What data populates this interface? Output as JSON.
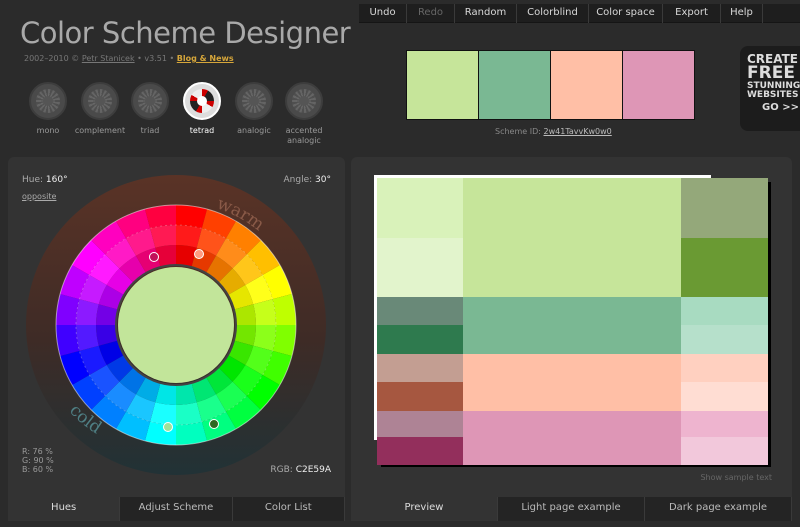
{
  "app": {
    "title": "Color Scheme Designer",
    "credits_prefix": "2002–2010 ©",
    "author": "Petr Stanicek",
    "version": "• v3.51 •",
    "blog": "Blog & News"
  },
  "menu": [
    {
      "label": "Undo",
      "disabled": false,
      "width": 48
    },
    {
      "label": "Redo",
      "disabled": true,
      "width": 48
    },
    {
      "label": "Random",
      "disabled": false,
      "width": 62
    },
    {
      "label": "Colorblind",
      "disabled": false,
      "width": 72
    },
    {
      "label": "Color space",
      "disabled": false,
      "width": 74
    },
    {
      "label": "Export",
      "disabled": false,
      "width": 58
    },
    {
      "label": "Help",
      "disabled": false,
      "width": 42
    }
  ],
  "modes": [
    {
      "label": "mono",
      "active": false
    },
    {
      "label": "complement",
      "active": false
    },
    {
      "label": "triad",
      "active": false
    },
    {
      "label": "tetrad",
      "active": true
    },
    {
      "label": "analogic",
      "active": false
    },
    {
      "label": "accented analogic",
      "active": false
    }
  ],
  "scheme": {
    "swatches": [
      "#C6E59A",
      "#7AB893",
      "#FFBFA6",
      "#DE96B6"
    ],
    "id_label": "Scheme ID:",
    "id_value": "2w41TavvKw0w0"
  },
  "ad": {
    "line1": "CREATE",
    "line2": "FREE",
    "line3": "STUNNING",
    "line4": "WEBSITES",
    "go": "GO >>"
  },
  "wheel": {
    "hue_label": "Hue:",
    "hue_value": "160°",
    "opposite": "opposite",
    "angle_label": "Angle:",
    "angle_value": "30°",
    "warm": "warm",
    "cold": "cold",
    "center_color": "#C2E59A",
    "r": "R: 76 %",
    "g": "G: 90 %",
    "b": "B: 60 %",
    "rgb_label": "RGB:",
    "rgb_value": "C2E59A"
  },
  "left_tabs": [
    {
      "label": "Hues",
      "active": true
    },
    {
      "label": "Adjust Scheme",
      "active": false
    },
    {
      "label": "Color List",
      "active": false
    }
  ],
  "right_tabs": [
    {
      "label": "Preview",
      "active": true
    },
    {
      "label": "Light page example",
      "active": false
    },
    {
      "label": "Dark page example",
      "active": false
    }
  ],
  "preview": {
    "show_text": "Show sample text",
    "rows": [
      [
        "#D9F2BA",
        "#C6E59A",
        "#94A87A"
      ],
      [
        "#E2F4CC",
        "#C6E59A",
        "#6A9A33"
      ],
      [
        "#698978",
        "#7AB893",
        "#A8DBC1"
      ],
      [
        "#2E7A4E",
        "#7AB893",
        "#B6E0CB"
      ],
      [
        "#C39E92",
        "#FFBFA6",
        "#FFD0C0"
      ],
      [
        "#A65740",
        "#FFBFA6",
        "#FFDDD3"
      ],
      [
        "#AE8395",
        "#DE96B6",
        "#EEB4CF"
      ],
      [
        "#932F5C",
        "#DE96B6",
        "#F2C8DB"
      ]
    ]
  }
}
